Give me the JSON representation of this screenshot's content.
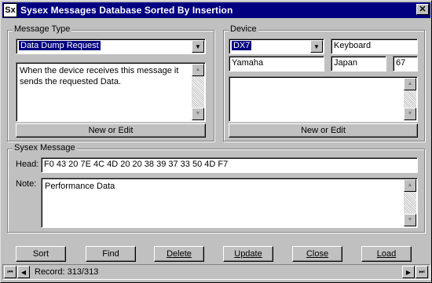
{
  "window": {
    "title": "Sysex Messages Database Sorted By Insertion",
    "icon_text": "Sx",
    "close_glyph": "✕"
  },
  "message_type": {
    "label": "Message Type",
    "selected": "Data Dump Request",
    "description": "When the device receives this message it sends the requested Data.",
    "edit_button": "New or Edit"
  },
  "device": {
    "label": "Device",
    "model": "DX7",
    "type": "Keyboard",
    "manufacturer": "Yamaha",
    "country": "Japan",
    "id": "67",
    "notes": "",
    "edit_button": "New or Edit"
  },
  "sysex": {
    "label": "Sysex Message",
    "head_label": "Head:",
    "head_value": "F0 43 20 7E 4C 4D 20 20 38 39 37 33 50 4D F7",
    "note_label": "Note:",
    "note_value": "Performance Data"
  },
  "buttons": {
    "sort": "Sort",
    "find": "Find",
    "delete": "Delete",
    "update": "Update",
    "close": "Close",
    "load": "Load"
  },
  "navigator": {
    "record_text": "Record: 313/313"
  },
  "icons": {
    "dropdown": "▼",
    "scroll_up": "▲",
    "scroll_down": "▼",
    "first": "⏮",
    "prev": "◀",
    "next": "▶",
    "last": "⏭"
  }
}
